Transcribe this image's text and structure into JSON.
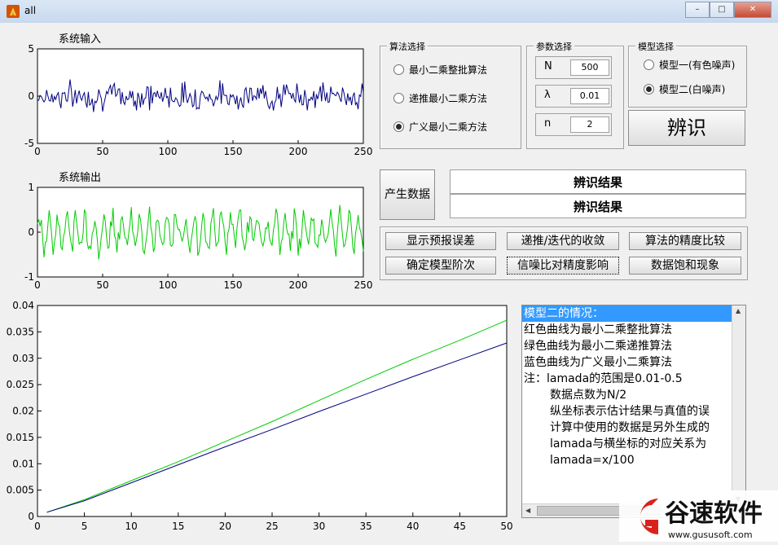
{
  "window": {
    "title": "all"
  },
  "axes1": {
    "title": "系统输入",
    "yticks": [
      "5",
      "0",
      "-5"
    ],
    "xticks": [
      "0",
      "50",
      "100",
      "150",
      "200",
      "250"
    ],
    "series_color": "#000080",
    "ylim": [
      -5,
      5
    ],
    "xlim": [
      0,
      250
    ]
  },
  "axes2": {
    "title": "系统输出",
    "yticks": [
      "1",
      "0",
      "-1"
    ],
    "xticks": [
      "0",
      "50",
      "100",
      "150",
      "200",
      "250"
    ],
    "series_color": "#00cc00",
    "ylim": [
      -1,
      1
    ],
    "xlim": [
      0,
      250
    ]
  },
  "algo_panel": {
    "title": "算法选择",
    "options": [
      "最小二乘整批算法",
      "递推最小二乘方法",
      "广义最小二乘方法"
    ],
    "selected": 2
  },
  "param_panel": {
    "title": "参数选择",
    "params": [
      {
        "label": "N",
        "value": "500"
      },
      {
        "label": "λ",
        "value": "0.01"
      },
      {
        "label": "n",
        "value": "2"
      }
    ]
  },
  "model_panel": {
    "title": "模型选择",
    "options": [
      "模型一(有色噪声)",
      "模型二(白噪声)"
    ],
    "selected": 1
  },
  "buttons": {
    "identify": "辨识",
    "generate": "产生数据",
    "show_error": "显示预报误差",
    "convergence": "递推/迭代的收敛",
    "precision_compare": "算法的精度比较",
    "order": "确定模型阶次",
    "snr": "信噪比对精度影响",
    "saturation": "数据饱和现象"
  },
  "results": {
    "line1": "辨识结果",
    "line2": "辨识结果"
  },
  "chart_data": {
    "type": "line",
    "title": "",
    "xlabel": "",
    "ylabel": "",
    "xlim": [
      0,
      50
    ],
    "ylim": [
      0,
      0.04
    ],
    "xticks": [
      "0",
      "5",
      "10",
      "15",
      "20",
      "25",
      "30",
      "35",
      "40",
      "45",
      "50"
    ],
    "yticks": [
      "0.04",
      "0.035",
      "0.03",
      "0.025",
      "0.02",
      "0.015",
      "0.01",
      "0.005",
      "0"
    ],
    "series": [
      {
        "color": "#00cc00",
        "x": [
          1,
          5,
          10,
          15,
          20,
          25,
          30,
          35,
          40,
          45,
          50
        ],
        "y": [
          0.0008,
          0.0032,
          0.0068,
          0.0104,
          0.0142,
          0.018,
          0.022,
          0.026,
          0.0298,
          0.0334,
          0.0372
        ]
      },
      {
        "color": "#000080",
        "x": [
          1,
          5,
          10,
          15,
          20,
          25,
          30,
          35,
          40,
          45,
          50
        ],
        "y": [
          0.0008,
          0.003,
          0.0064,
          0.0098,
          0.0132,
          0.0165,
          0.0199,
          0.0232,
          0.0265,
          0.0297,
          0.0329
        ]
      }
    ]
  },
  "info_list": {
    "lines": [
      {
        "text": "模型二的情况：",
        "indent": false,
        "selected": true
      },
      {
        "text": "红色曲线为最小二乘整批算法",
        "indent": false,
        "selected": false
      },
      {
        "text": "绿色曲线为最小二乘递推算法",
        "indent": false,
        "selected": false
      },
      {
        "text": "蓝色曲线为广义最小二乘算法",
        "indent": false,
        "selected": false
      },
      {
        "text": "注：lamada的范围是0.01-0.5",
        "indent": false,
        "selected": false
      },
      {
        "text": "数据点数为N/2",
        "indent": true,
        "selected": false
      },
      {
        "text": "纵坐标表示估计结果与真值的误",
        "indent": true,
        "selected": false
      },
      {
        "text": "计算中使用的数据是另外生成的",
        "indent": true,
        "selected": false
      },
      {
        "text": "lamada与横坐标的对应关系为",
        "indent": true,
        "selected": false
      },
      {
        "text": "lamada=x/100",
        "indent": true,
        "selected": false
      }
    ]
  },
  "watermark": {
    "brand": "谷速软件",
    "url": "www.gususoft.com"
  }
}
